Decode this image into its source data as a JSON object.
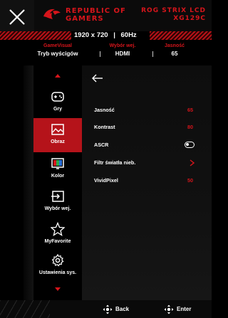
{
  "header": {
    "brand_line1": "REPUBLIC OF",
    "brand_line2": "GAMERS",
    "model_line1": "ROG STRIX LCD",
    "model_line2": "XG129C"
  },
  "infobar": {
    "resolution": "1920 x 720",
    "refresh": "60Hz"
  },
  "status": {
    "gamevisual_label": "GameVisual",
    "gamevisual_value": "Tryb wyścigów",
    "input_label": "Wybór wej.",
    "input_value": "HDMI",
    "brightness_label": "Jasność",
    "brightness_value": "65"
  },
  "sidebar": {
    "items": [
      {
        "label": "Gry",
        "icon": "gamepad-icon"
      },
      {
        "label": "Obraz",
        "icon": "image-icon"
      },
      {
        "label": "Kolor",
        "icon": "color-icon"
      },
      {
        "label": "Wybór wej.",
        "icon": "input-icon"
      },
      {
        "label": "MyFavorite",
        "icon": "star-icon"
      },
      {
        "label": "Ustawienia sys.",
        "icon": "gear-icon"
      }
    ],
    "active_index": 1
  },
  "panel": {
    "settings": [
      {
        "name": "Jasność",
        "value": "65"
      },
      {
        "name": "Kontrast",
        "value": "80"
      },
      {
        "name": "ASCR",
        "value": ""
      },
      {
        "name": "Filtr światła nieb.",
        "value": ""
      },
      {
        "name": "VividPixel",
        "value": "50"
      }
    ]
  },
  "footer": {
    "back_label": "Back",
    "enter_label": "Enter"
  },
  "colors": {
    "accent": "#d6151b",
    "active_bg": "#b5131a"
  }
}
